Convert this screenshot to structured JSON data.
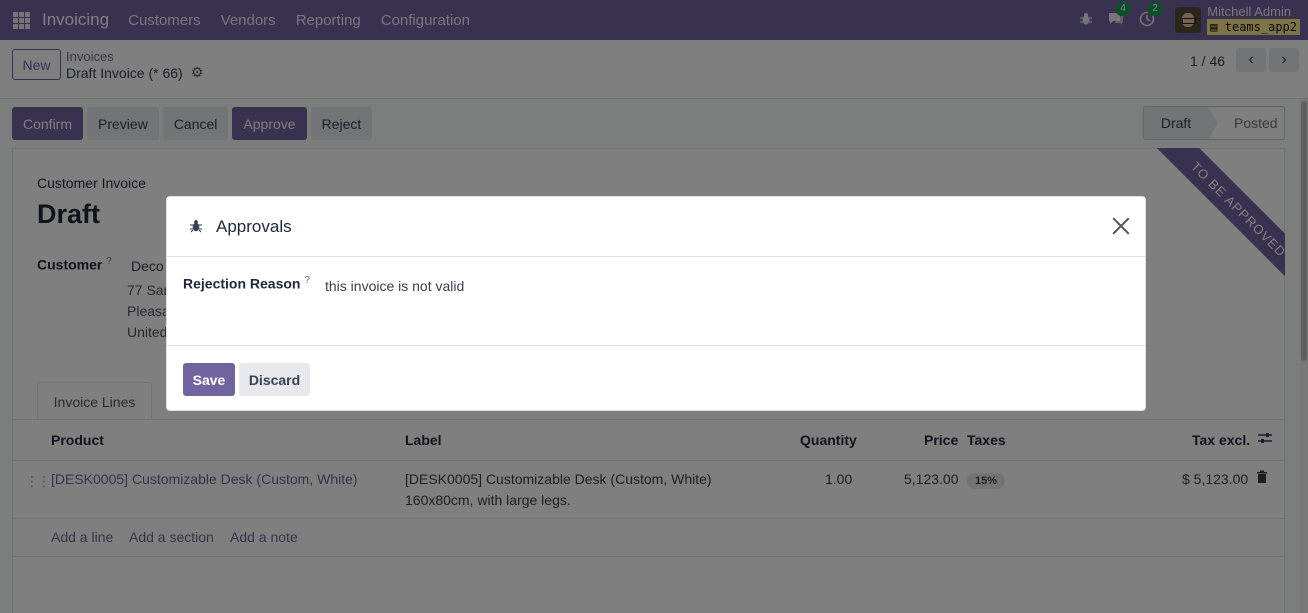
{
  "navbar": {
    "app_name": "Invoicing",
    "menu": [
      "Customers",
      "Vendors",
      "Reporting",
      "Configuration"
    ],
    "messages_count": "4",
    "activities_count": "2",
    "user_name": "Mitchell Admin",
    "db_name": "teams_app2",
    "icons": [
      "apps-grid-icon",
      "bug-icon",
      "chat-icon",
      "clock-icon"
    ]
  },
  "control": {
    "new_label": "New",
    "breadcrumb_parent": "Invoices",
    "breadcrumb_current": "Draft Invoice (* 66)",
    "pager": "1 / 46"
  },
  "actions": {
    "confirm": "Confirm",
    "preview": "Preview",
    "cancel": "Cancel",
    "approve": "Approve",
    "reject": "Reject"
  },
  "status": {
    "draft": "Draft",
    "posted": "Posted"
  },
  "form": {
    "ribbon": "TO BE APPROVED",
    "doc_type": "Customer Invoice",
    "title": "Draft",
    "customer_label": "Customer",
    "customer_name": "Deco",
    "address": [
      "77 San",
      "Pleasa",
      "United"
    ],
    "tab": "Invoice Lines",
    "columns": {
      "product": "Product",
      "label": "Label",
      "quantity": "Quantity",
      "price": "Price",
      "taxes": "Taxes",
      "tax_excl": "Tax excl."
    },
    "line": {
      "product": "[DESK0005] Customizable Desk (Custom, White)",
      "label_line1": "[DESK0005] Customizable Desk (Custom, White)",
      "label_line2": "160x80cm, with large legs.",
      "quantity": "1.00",
      "price": "5,123.00",
      "tax": "15%",
      "subtotal": "$ 5,123.00"
    },
    "add_line": "Add a line",
    "add_section": "Add a section",
    "add_note": "Add a note"
  },
  "modal": {
    "title": "Approvals",
    "rejection_label": "Rejection Reason",
    "rejection_value": "this invoice is not valid",
    "save": "Save",
    "discard": "Discard"
  },
  "colors": {
    "brand": "#71639e",
    "badge": "#1f9d55"
  }
}
